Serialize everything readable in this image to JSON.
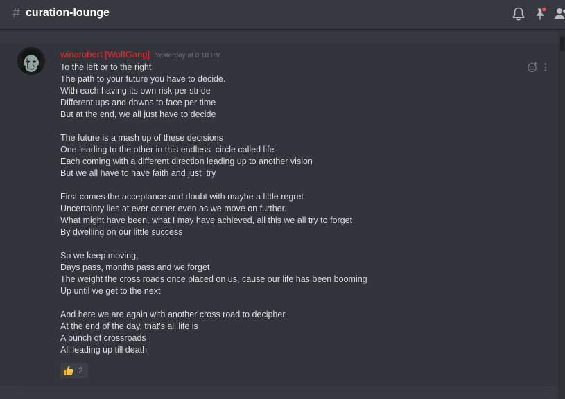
{
  "header": {
    "hash_symbol": "#",
    "channel_name": "curation-lounge",
    "icons": [
      "bell-icon",
      "pin-icon",
      "members-icon"
    ]
  },
  "message": {
    "author": "winarobert [WolfGang]",
    "timestamp": "Yesterday at 8:18 PM",
    "author_color": "#e62b2b",
    "lines": [
      "To the left or to the right",
      "The path to your future you have to decide.",
      "With each having its own risk per stride",
      "Different ups and downs to face per time",
      "But at the end, we all just have to decide",
      "",
      "The future is a mash up of these decisions",
      "One leading to the other in this endless  circle called life",
      "Each coming with a different direction leading up to another vision",
      "But we all have to have faith and just  try",
      "",
      "First comes the acceptance and doubt with maybe a little regret",
      "Uncertainty lies at ever corner even as we move on further.",
      "What might have been, what I may have achieved, all this we all try to forget",
      "By dwelling on our little success",
      "",
      "So we keep moving,",
      "Days pass, months pass and we forget",
      "The weight the cross roads once placed on us, cause our life has been booming",
      "Up until we get to the next",
      "",
      "And here we are again with another cross road to decipher.",
      "At the end of the day, that's all life is",
      "A bunch of crossroads",
      "All leading up till death"
    ],
    "reaction": {
      "emoji": "thumbs-up-icon",
      "count": "2"
    }
  },
  "colors": {
    "background": "#36393f",
    "message_hover": "#32353b",
    "text": "#dcddde",
    "muted": "#72767d",
    "notification_dot": "#f04747"
  }
}
